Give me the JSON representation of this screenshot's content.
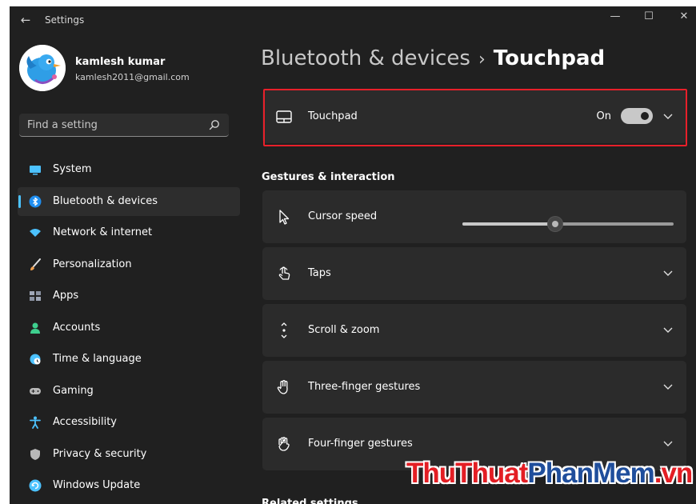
{
  "window": {
    "title": "Settings",
    "back_icon": "back-arrow-icon"
  },
  "controls": [
    "minimize-icon",
    "maximize-icon",
    "close-icon"
  ],
  "profile": {
    "name": "kamlesh kumar",
    "email": "kamlesh2011@gmail.com"
  },
  "search": {
    "placeholder": "Find a setting"
  },
  "sidebar": {
    "items": [
      {
        "label": "System",
        "icon": "system-icon",
        "color": "#4cc2ff"
      },
      {
        "label": "Bluetooth & devices",
        "icon": "bluetooth-icon",
        "color": "#1f8ef0",
        "active": true
      },
      {
        "label": "Network & internet",
        "icon": "network-icon",
        "color": "#4cc2ff"
      },
      {
        "label": "Personalization",
        "icon": "brush-icon",
        "color": "#f0a050"
      },
      {
        "label": "Apps",
        "icon": "apps-icon",
        "color": "#a0a8b8"
      },
      {
        "label": "Accounts",
        "icon": "accounts-icon",
        "color": "#3ecf8e"
      },
      {
        "label": "Time & language",
        "icon": "globe-icon",
        "color": "#4cc2ff"
      },
      {
        "label": "Gaming",
        "icon": "gamepad-icon",
        "color": "#b8b8b8"
      },
      {
        "label": "Accessibility",
        "icon": "accessibility-icon",
        "color": "#4cc2ff"
      },
      {
        "label": "Privacy & security",
        "icon": "shield-icon",
        "color": "#b8b8b8"
      },
      {
        "label": "Windows Update",
        "icon": "update-icon",
        "color": "#4cc2ff"
      }
    ]
  },
  "breadcrumb": {
    "parent": "Bluetooth & devices",
    "separator": "›",
    "current": "Touchpad"
  },
  "touchpad": {
    "label": "Touchpad",
    "state": "On",
    "enabled": true
  },
  "section": {
    "title": "Gestures & interaction"
  },
  "cursor_speed": {
    "label": "Cursor speed",
    "value": 0.44
  },
  "settings": [
    {
      "label": "Taps",
      "icon": "tap-icon"
    },
    {
      "label": "Scroll & zoom",
      "icon": "scroll-icon"
    },
    {
      "label": "Three-finger gestures",
      "icon": "three-finger-icon"
    },
    {
      "label": "Four-finger gestures",
      "icon": "four-finger-icon"
    }
  ],
  "related": {
    "title": "Related settings"
  },
  "watermark": {
    "part1": "ThuThuat",
    "part2": "PhanMem",
    "part3": ".vn"
  },
  "colors": {
    "accent": "#4cc2ff",
    "highlight": "#e8202a",
    "background": "#202020",
    "card": "#2b2b2b"
  }
}
